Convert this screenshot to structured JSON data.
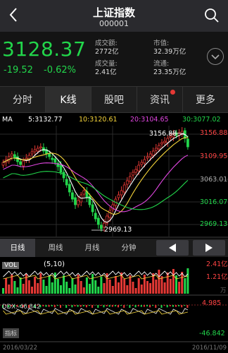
{
  "header": {
    "title": "上证指数",
    "code": "000001"
  },
  "quote": {
    "price": "3128.37",
    "change": "-19.52",
    "change_pct": "-0.62%",
    "stats": [
      {
        "label": "成交额:",
        "value": "2772亿"
      },
      {
        "label": "市值:",
        "value": "32.39万亿"
      },
      {
        "label": "成交量:",
        "value": "2.41亿"
      },
      {
        "label": "流通:",
        "value": "23.35万亿"
      }
    ]
  },
  "tabs": [
    "分时",
    "K线",
    "股吧",
    "资讯",
    "更多"
  ],
  "ma": {
    "label": "MA",
    "ma5": "5:3132.77",
    "ma10": "10:3120.61",
    "ma20": "20:3104.65",
    "ma30": "30:3077.02"
  },
  "price_axis": [
    "3156.88",
    "3109.95",
    "3063.01",
    "3016.07",
    "2969.13"
  ],
  "annotations": {
    "high": "3156.88",
    "low": "2969.13"
  },
  "period_tabs": [
    "日线",
    "周线",
    "月线",
    "分钟"
  ],
  "volume": {
    "label": "VOL",
    "value": "(5,10)",
    "axis": [
      "2.41亿",
      "1.21亿"
    ],
    "axis_left": "万"
  },
  "macd": {
    "label": "DDX:-46.842",
    "axis_top": "4.985",
    "axis_bottom": "-46.842"
  },
  "indicator_tab": "指标",
  "dates": {
    "start": "2016/03/22",
    "end": "2016/11/09"
  },
  "colors": {
    "up": "#e53935",
    "down": "#22d64b",
    "ma5": "#ffffff",
    "ma10": "#f5d43a",
    "ma20": "#e046e0",
    "ma30": "#22d64b",
    "axis_red": "#ff4444"
  }
}
